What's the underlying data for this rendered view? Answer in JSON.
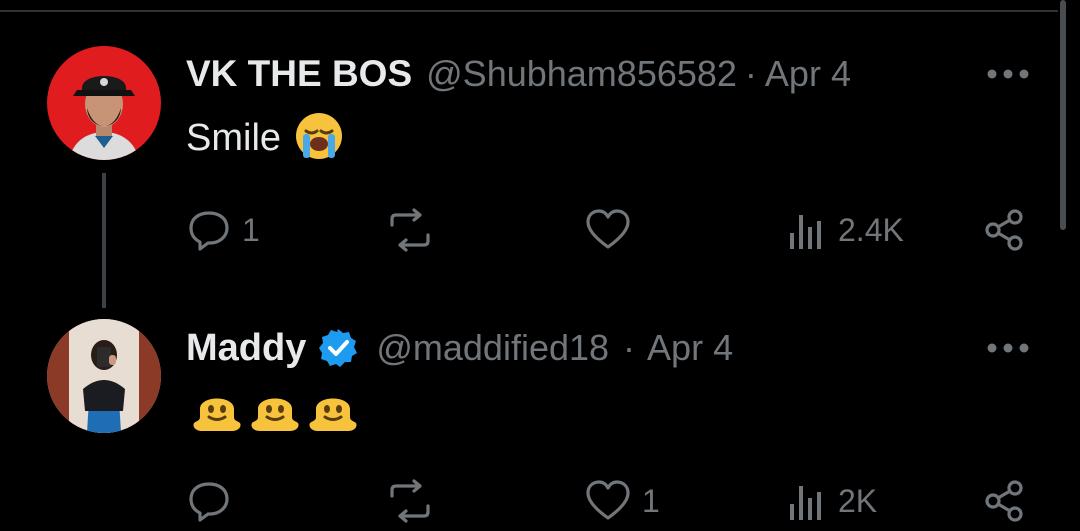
{
  "tweets": [
    {
      "name": "VK THE BOS",
      "handle": "@Shubham856582",
      "separator": "·",
      "date": "Apr 4",
      "text": "Smile",
      "emoji": [
        "loudly-crying-face"
      ],
      "verified": false,
      "avatar": "avatar-person-cap",
      "actions": {
        "reply_count": "1",
        "retweet_count": "",
        "like_count": "",
        "views_count": "2.4K"
      }
    },
    {
      "name": "Maddy",
      "handle": "@maddified18",
      "separator": "·",
      "date": "Apr 4",
      "text": "",
      "emoji": [
        "melting-face",
        "melting-face",
        "melting-face"
      ],
      "verified": true,
      "avatar": "avatar-mirror-selfie",
      "actions": {
        "reply_count": "",
        "retweet_count": "",
        "like_count": "1",
        "views_count": "2K"
      }
    }
  ],
  "colors": {
    "background": "#000000",
    "primary_text": "#e7e9ea",
    "secondary_text": "#71767b",
    "verified_blue": "#1d9bf0",
    "divider": "#2f3336"
  },
  "icons": {
    "reply": "reply-icon",
    "retweet": "retweet-icon",
    "like": "heart-icon",
    "views": "views-icon",
    "share": "share-icon",
    "more": "more-options-icon"
  }
}
